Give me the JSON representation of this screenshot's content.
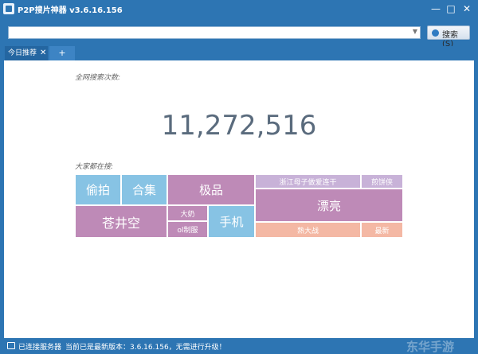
{
  "window": {
    "title": "P2P搜片神器 v3.6.16.156"
  },
  "controls": {
    "minimize": "—",
    "maximize": "□",
    "close": "✕"
  },
  "search": {
    "value": "",
    "placeholder": "",
    "button_label": "搜索(S)"
  },
  "tabs": [
    {
      "label": "今日推荐",
      "close": "✕"
    },
    {
      "label": "+"
    }
  ],
  "main": {
    "total_label": "全网搜索次数:",
    "total_count": "11,272,516",
    "hot_label": "大家都在搜:",
    "hot_terms": [
      "偷拍",
      "合集",
      "苍井空",
      "极品",
      "大奶",
      "ol制服",
      "手机",
      "浙江母子做爱连干",
      "煎饼侠",
      "漂亮",
      "熟大战",
      "最新"
    ]
  },
  "statusbar": {
    "connection": "已连接服务器",
    "version_text": "当前已是最新版本：3.6.16.156，无需进行升级！",
    "watermark": "东华手游"
  },
  "colors": {
    "window_blue": "#2d75b3",
    "tile_blue": "#87c3e4",
    "tile_purple": "#be8ab7",
    "tile_lilac": "#c8b2d8",
    "tile_peach": "#f4b8a4"
  },
  "icons": {
    "app": "app-icon",
    "search": "search-icon",
    "status": "connection-icon"
  }
}
